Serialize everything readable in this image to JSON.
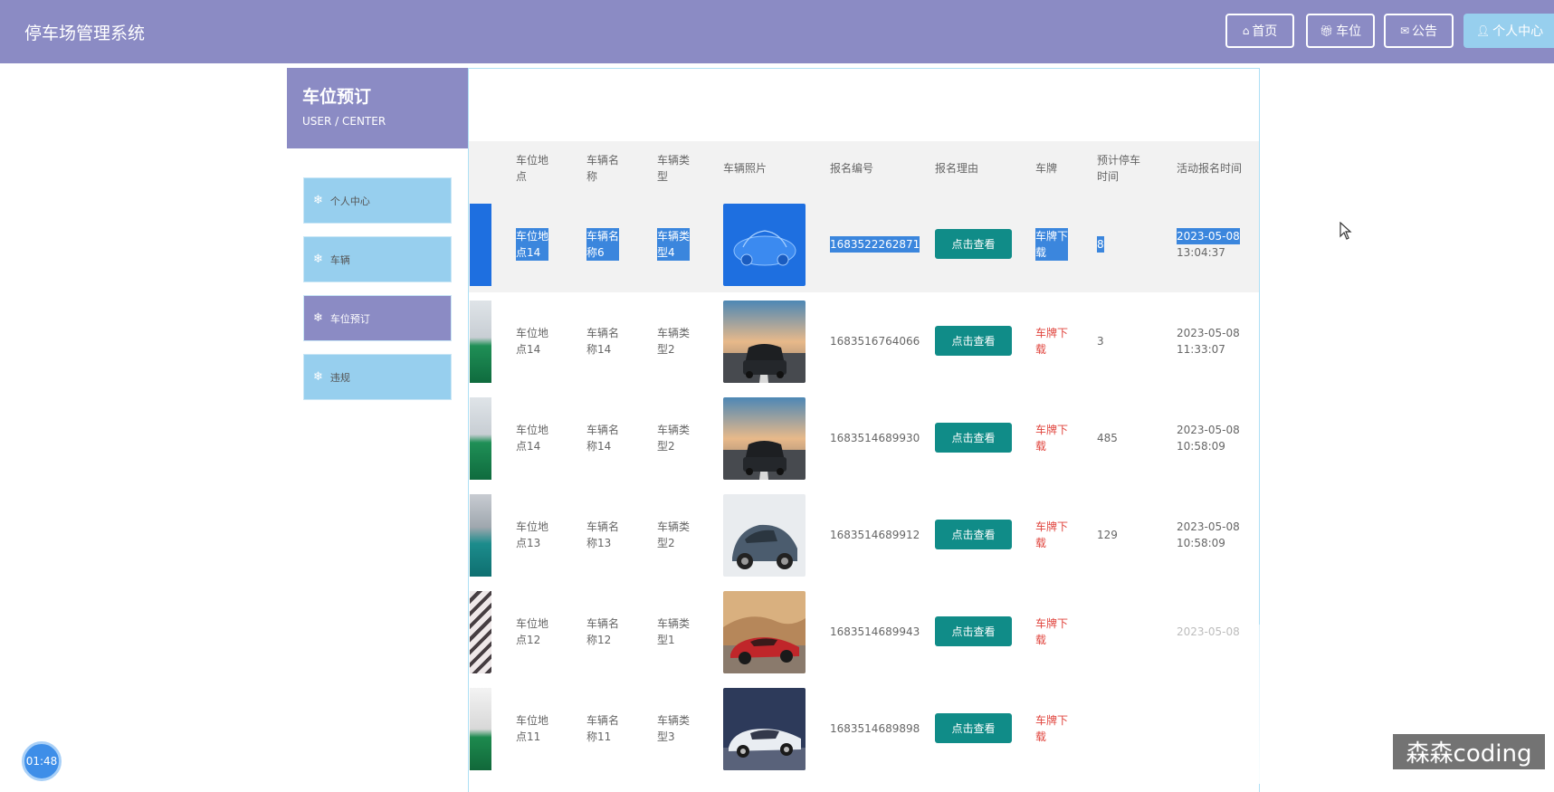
{
  "header": {
    "title": "停车场管理系统",
    "nav": [
      {
        "label": "首页",
        "icon": "home-icon"
      },
      {
        "label": "车位",
        "icon": "gift-icon"
      },
      {
        "label": "公告",
        "icon": "mail-icon"
      },
      {
        "label": "个人中心",
        "icon": "user-icon"
      }
    ]
  },
  "sidebar": {
    "title": "车位预订",
    "subtitle": "USER / CENTER",
    "items": [
      {
        "label": "个人中心"
      },
      {
        "label": "车辆"
      },
      {
        "label": "车位预订"
      },
      {
        "label": "违规"
      }
    ]
  },
  "table": {
    "columns": [
      "车位地\n点",
      "车辆名\n称",
      "车辆类\n型",
      "车辆照片",
      "报名编号",
      "报名理由",
      "车牌",
      "预计停车\n时间",
      "活动报名时间"
    ],
    "button_label": "点击查看",
    "rows": [
      {
        "location": "车位地\n点14",
        "name": "车辆名\n称6",
        "type": "车辆类\n型4",
        "photo": "blue-car",
        "edge": "blue",
        "number": "1683522262871",
        "plate": "车牌下\n载",
        "hours": "8",
        "date": "2023-05-08",
        "time": "13:04:37"
      },
      {
        "location": "车位地\n点14",
        "name": "车辆名\n称14",
        "type": "车辆类\n型2",
        "photo": "dark-suv",
        "edge": "garage",
        "number": "1683516764066",
        "plate": "车牌下\n载",
        "hours": "3",
        "date": "2023-05-08",
        "time": "11:33:07"
      },
      {
        "location": "车位地\n点14",
        "name": "车辆名\n称14",
        "type": "车辆类\n型2",
        "photo": "dark-suv",
        "edge": "garage",
        "number": "1683514689930",
        "plate": "车牌下\n载",
        "hours": "485",
        "date": "2023-05-08",
        "time": "10:58:09"
      },
      {
        "location": "车位地\n点13",
        "name": "车辆名\n称13",
        "type": "车辆类\n型2",
        "photo": "grey-hatch",
        "edge": "lot",
        "number": "1683514689912",
        "plate": "车牌下\n载",
        "hours": "129",
        "date": "2023-05-08",
        "time": "10:58:09"
      },
      {
        "location": "车位地\n点12",
        "name": "车辆名\n称12",
        "type": "车辆类\n型1",
        "photo": "red-sport",
        "edge": "bikes",
        "number": "1683514689943",
        "plate": "车牌下\n载",
        "hours": "",
        "date": "2023-05-08",
        "time": ""
      },
      {
        "location": "车位地\n点11",
        "name": "车辆名\n称11",
        "type": "车辆类\n型3",
        "photo": "white-sedan",
        "edge": "garage2",
        "number": "1683514689898",
        "plate": "车牌下\n载",
        "hours": "",
        "date": "",
        "time": ""
      }
    ]
  },
  "overlay": {
    "timer": "01:48",
    "watermark": "森森coding"
  },
  "colors": {
    "header": "#8b8bc4",
    "side_item": "#97cfee",
    "view_button": "#108c88",
    "plate_text": "#e0443d",
    "selection": "#3b86dd"
  }
}
